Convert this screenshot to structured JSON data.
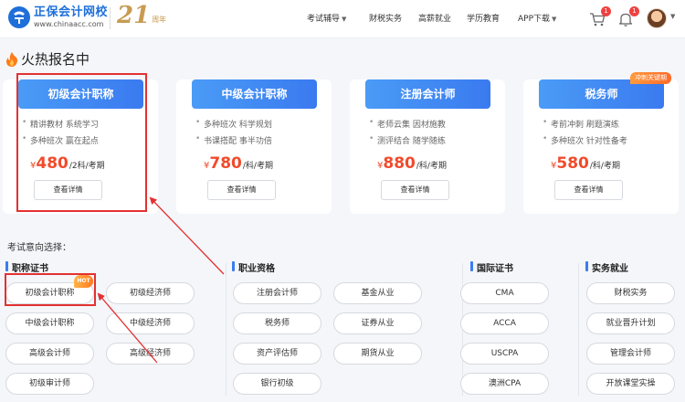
{
  "header": {
    "brand": "正保会计网校",
    "url": "www.chinaacc.com",
    "anniversary_number": "21",
    "anniversary_label": "周年",
    "nav": [
      {
        "label": "考试辅导",
        "has_caret": true
      },
      {
        "label": "财税实务",
        "has_caret": false
      },
      {
        "label": "高薪就业",
        "has_caret": false
      },
      {
        "label": "学历教育",
        "has_caret": false
      },
      {
        "label": "APP下载",
        "has_caret": true
      }
    ],
    "cart_badge": "1",
    "bell_badge": "1"
  },
  "hot": {
    "title": "火热报名中",
    "cards": [
      {
        "title": "初级会计职称",
        "features": [
          "精讲教材 系统学习",
          "多种班次 赢在起点"
        ],
        "currency": "¥",
        "price": "480",
        "unit": "/2科/考期",
        "button": "查看详情",
        "tag": ""
      },
      {
        "title": "中级会计职称",
        "features": [
          "多种班次 科学规划",
          "书课搭配 事半功倍"
        ],
        "currency": "¥",
        "price": "780",
        "unit": "/科/考期",
        "button": "查看详情",
        "tag": ""
      },
      {
        "title": "注册会计师",
        "features": [
          "老师云集 因材施教",
          "测评结合 随学随练"
        ],
        "currency": "¥",
        "price": "880",
        "unit": "/科/考期",
        "button": "查看详情",
        "tag": ""
      },
      {
        "title": "税务师",
        "features": [
          "考前冲刺 刷题演练",
          "多种班次 针对性备考"
        ],
        "currency": "¥",
        "price": "580",
        "unit": "/科/考期",
        "button": "查看详情",
        "tag": "冲刺关键期"
      }
    ]
  },
  "intent": {
    "label": "考试意向选择：",
    "hot_tag": "HOT",
    "categories": [
      {
        "name": "职称证书",
        "items": [
          "初级会计职称",
          "初级经济师",
          "中级会计职称",
          "中级经济师",
          "高级会计师",
          "高级经济师",
          "初级审计师"
        ]
      },
      {
        "name": "职业资格",
        "items": [
          "注册会计师",
          "基金从业",
          "税务师",
          "证券从业",
          "资产评估师",
          "期货从业",
          "银行初级"
        ]
      },
      {
        "name": "国际证书",
        "items": [
          "CMA",
          "ACCA",
          "USCPA",
          "澳洲CPA"
        ]
      },
      {
        "name": "实务就业",
        "items": [
          "财税实务",
          "就业晋升计划",
          "管理会计师",
          "开放课堂实操"
        ]
      }
    ]
  },
  "colors": {
    "accent": "#3b7cf2",
    "price": "#f04b2c",
    "highlight": "#e33131",
    "gold": "#c89b53"
  }
}
